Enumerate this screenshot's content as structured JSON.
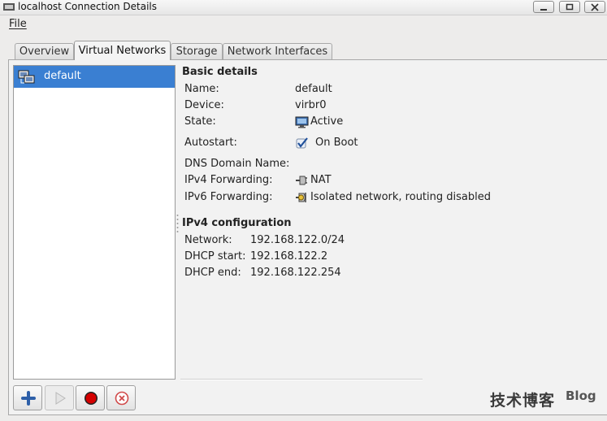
{
  "window": {
    "title": "localhost Connection Details"
  },
  "menu": {
    "file": "File"
  },
  "tabs": [
    {
      "label": "Overview"
    },
    {
      "label": "Virtual Networks"
    },
    {
      "label": "Storage"
    },
    {
      "label": "Network Interfaces"
    }
  ],
  "networks": [
    {
      "name": "default"
    }
  ],
  "basic": {
    "heading": "Basic details",
    "name_label": "Name:",
    "name_value": "default",
    "device_label": "Device:",
    "device_value": "virbr0",
    "state_label": "State:",
    "state_value": "Active",
    "autostart_label": "Autostart:",
    "autostart_value": "On Boot",
    "dns_label": "DNS Domain Name:",
    "ipv4fwd_label": "IPv4 Forwarding:",
    "ipv4fwd_value": "NAT",
    "ipv6fwd_label": "IPv6 Forwarding:",
    "ipv6fwd_value": "Isolated network, routing disabled"
  },
  "ipv4": {
    "heading": "IPv4 configuration",
    "network_label": "Network:",
    "network_value": "192.168.122.0/24",
    "dhcp_start_label": "DHCP start:",
    "dhcp_start_value": "192.168.122.2",
    "dhcp_end_label": "DHCP end:",
    "dhcp_end_value": "192.168.122.254"
  },
  "watermark": {
    "chinese": "技术博客",
    "english": "Blog"
  },
  "colors": {
    "selection": "#3a7fd2",
    "window_bg": "#edeceb",
    "stop_red": "#d40000"
  }
}
